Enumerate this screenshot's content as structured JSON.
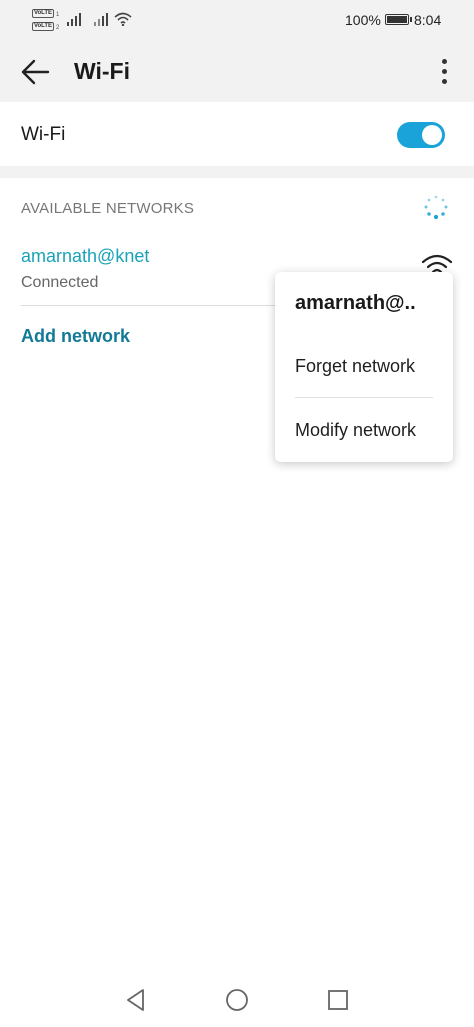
{
  "status_bar": {
    "volte_badges": [
      "VoLTE",
      "VoLTE"
    ],
    "volte_sub": [
      "1",
      "2"
    ],
    "battery_percent": "100%",
    "time": "8:04",
    "icons": [
      "sim1-signal-icon",
      "sim2-signal-icon",
      "wifi-status-icon",
      "battery-icon"
    ]
  },
  "app_bar": {
    "title": "Wi-Fi",
    "back_icon": "arrow-left-icon",
    "menu_icon": "more-vertical-icon"
  },
  "wifi_toggle": {
    "label": "Wi-Fi",
    "enabled": true,
    "accent_color": "#1aa3d9"
  },
  "networks": {
    "section_title": "AVAILABLE NETWORKS",
    "scanning_icon": "spinner-icon",
    "items": [
      {
        "name": "amarnath@knet",
        "status": "Connected",
        "signal_icon": "wifi-signal-icon",
        "name_color": "#1aa3b8"
      }
    ],
    "add_label": "Add network"
  },
  "popup_menu": {
    "title": "amarnath@..",
    "items": [
      {
        "label": "Forget network"
      },
      {
        "label": "Modify network"
      }
    ]
  },
  "nav_bar": {
    "buttons": [
      "back-triangle-icon",
      "home-circle-icon",
      "recents-square-icon"
    ]
  }
}
